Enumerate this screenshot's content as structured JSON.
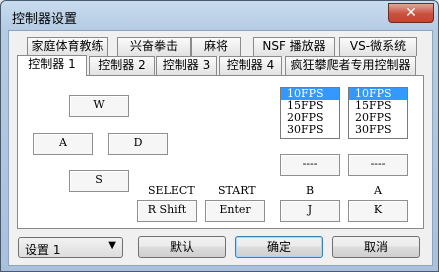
{
  "window": {
    "title": "控制器设置",
    "close_glyph": "✕",
    "close_icon": "close-icon"
  },
  "tabs_row1": [
    "家庭体育教练",
    "兴奋拳击",
    "麻将",
    "NSF 播放器",
    "VS-微系统"
  ],
  "tabs_row2": [
    "控制器 1",
    "控制器 2",
    "控制器 3",
    "控制器 4",
    "疯狂攀爬者专用控制器"
  ],
  "active_tab": "控制器 1",
  "dpad": {
    "up": "W",
    "left": "A",
    "right": "D",
    "down": "S"
  },
  "select": {
    "label": "SELECT",
    "key": "R Shift"
  },
  "start": {
    "label": "START",
    "key": "Enter"
  },
  "b_button": {
    "label": "B",
    "key": "J",
    "turbo": "----"
  },
  "a_button": {
    "label": "A",
    "key": "K",
    "turbo": "----"
  },
  "turbo_options": [
    "10FPS",
    "15FPS",
    "20FPS",
    "30FPS"
  ],
  "turbo_b_selected": "10FPS",
  "turbo_a_selected": "10FPS",
  "profile": {
    "value": "设置 1",
    "dropdown_icon": "chevron-down-icon"
  },
  "buttons": {
    "default": "默认",
    "ok": "确定",
    "cancel": "取消"
  },
  "colors": {
    "selection": "#3399ff",
    "close_button": "#c7442f",
    "titlebar": "#b9cfe6"
  }
}
